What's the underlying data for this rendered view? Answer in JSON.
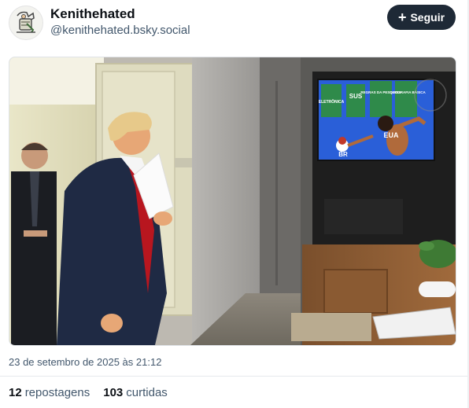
{
  "author": {
    "display_name": "Kenithehated",
    "handle": "@kenithehated.bsky.social",
    "avatar_icon": "cartoon-avatar"
  },
  "follow_button": {
    "icon": "plus-icon",
    "label": "Seguir"
  },
  "image": {
    "tv_labels": [
      "ELETRÔNICA",
      "SUS",
      "REGRAS DA PESQUISA",
      "GEOGRAFIA BÁSICA",
      "EUA",
      "BR"
    ]
  },
  "post": {
    "timestamp": "23 de setembro de 2025 às 21:12"
  },
  "stats": {
    "reposts_count": "12",
    "reposts_label": "repostagens",
    "likes_count": "103",
    "likes_label": "curtidas"
  },
  "colors": {
    "follow_bg": "#1e2936",
    "muted_text": "#42576c"
  }
}
